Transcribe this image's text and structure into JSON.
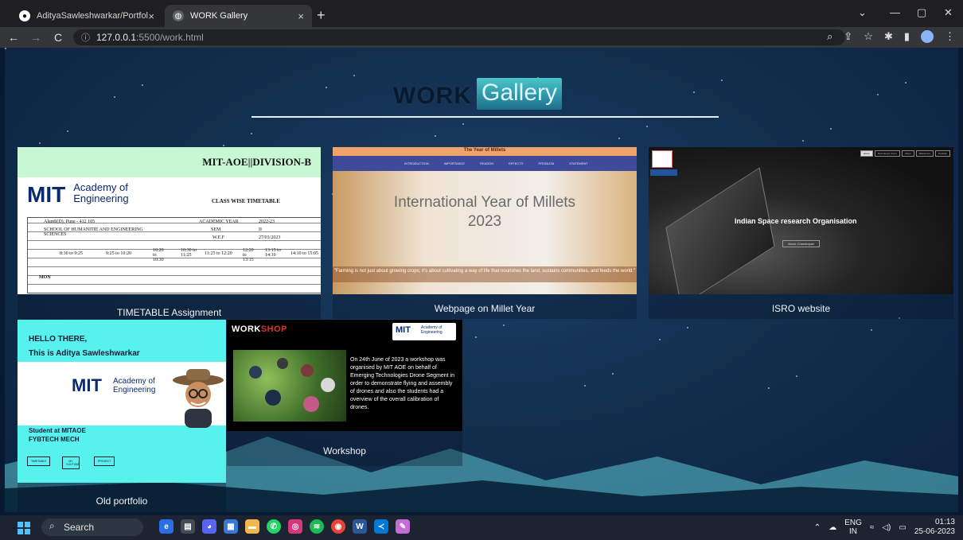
{
  "browser": {
    "tabs": [
      {
        "title": "AdityaSawleshwarkar/Portfolio",
        "close": "×"
      },
      {
        "title": "WORK Gallery",
        "close": "×"
      }
    ],
    "new_tab": "+",
    "window_controls": {
      "dropdown": "⌄",
      "minimize": "—",
      "maximize": "▢",
      "close": "✕"
    },
    "address": {
      "host": "127.0.0.1",
      "port_path": ":5500/work.html"
    },
    "nav": {
      "back": "←",
      "forward": "→",
      "reload": "C"
    }
  },
  "page": {
    "brand_bold": "WORK",
    "brand_light": "Gallery",
    "cards": [
      {
        "caption": "TIMETABLE Assignment"
      },
      {
        "caption": "Webpage on Millet Year"
      },
      {
        "caption": "ISRO website"
      },
      {
        "caption": "Old portfolio"
      },
      {
        "caption": "Workshop"
      }
    ],
    "timetable": {
      "header": "MIT-AOE||DIVISION-B",
      "logo_mit": "MIT",
      "logo_line1": "Academy of",
      "logo_line2": "Engineering",
      "subtitle": "CLASS WISE TIMETABLE",
      "rows": [
        "Alandi(D), Pune - 412 105",
        "SCHOOL OF HUMANITIE AND ENGINEERING SCIENCES",
        "ACADEMIC YEAR",
        "SEM",
        "W.E.F",
        "2022-23",
        "II",
        "27/03/2023"
      ],
      "times": [
        "8:30 to 9:25",
        "9:25 to 10:20",
        "10:20 to 10:30",
        "10:30 to 11:25",
        "11:25 to 12:20",
        "12:20 to 13:15",
        "13:15 to 14:10",
        "14:10 to 15:05"
      ],
      "day": "MON"
    },
    "millet": {
      "title": "The Year of Millets",
      "menu": "INTRODUCTION IMPORTANCE REASON EFFECTS PROBLEM STATEMENT",
      "headline_1": "International Year of Millets",
      "headline_2": "2023",
      "quote": "\"Farming is not just about growing crops; it's about cultivating a way of life that nourishes the land, sustains communities, and feeds the world.\""
    },
    "isro": {
      "heading": "Indian Space research Organisation",
      "button": "About Chandrayan",
      "menu": [
        "Home",
        "Recruitment Form",
        "About",
        "Milestones",
        "Portfolio"
      ]
    },
    "old_portfolio": {
      "hello": "HELLO THERE,",
      "name": "This is Aditya Sawleshwarkar",
      "logo_mit": "MIT",
      "logo_line1": "Academy of",
      "logo_line2": "Engineering",
      "student_1": "Student at MITAOE",
      "student_2": "FYBTECH MECH",
      "pills": [
        "TIMETABLE",
        "MY YOUTUBE",
        "PROJECT"
      ]
    },
    "workshop": {
      "head_white": "WORK",
      "head_red": "SHOP",
      "logo_mit": "MIT",
      "logo_text": "Academy of Engineering",
      "text": "On 24th June of 2023 a workshop was organised by MIT AOE on behalf of Emerging Technologies Drone Segment in order to demonstrate flying and assembly of drones and also the students had a overview of the overall calibration of drones."
    }
  },
  "taskbar": {
    "search": "Search",
    "lang_1": "ENG",
    "lang_2": "IN",
    "time": "01:13",
    "date": "25-06-2023",
    "pinned": [
      "edge",
      "file-explorer",
      "discord",
      "store",
      "folder",
      "whatsapp",
      "instagram",
      "spotify",
      "chrome",
      "word",
      "vscode",
      "paint"
    ]
  },
  "colors": {
    "accent": "#58f2ee",
    "brand_gallery": "#2a8aa0",
    "workshop_red": "#e0322a"
  }
}
